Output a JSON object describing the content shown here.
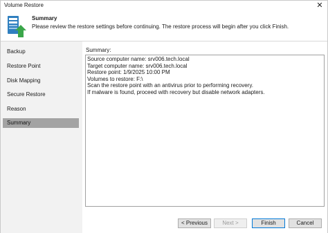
{
  "window": {
    "title": "Volume Restore",
    "close_glyph": "✕"
  },
  "header": {
    "icon": "server-restore-icon",
    "title": "Summary",
    "description": "Please review the restore settings before continuing. The restore process will begin after you click Finish."
  },
  "sidebar": {
    "items": [
      {
        "label": "Backup",
        "active": false
      },
      {
        "label": "Restore Point",
        "active": false
      },
      {
        "label": "Disk Mapping",
        "active": false
      },
      {
        "label": "Secure Restore",
        "active": false
      },
      {
        "label": "Reason",
        "active": false
      },
      {
        "label": "Summary",
        "active": true
      }
    ]
  },
  "summary": {
    "label": "Summary:",
    "lines": [
      "Source computer name: srv006.tech.local",
      "Target computer name: srv006.tech.local",
      "Restore point: 1/9/2025 10:00 PM",
      "Volumes to restore: F:\\",
      "Scan the restore point with an antivirus prior to performing recovery.",
      "If malware is found, proceed with recovery but disable network adapters."
    ]
  },
  "buttons": {
    "previous": "< Previous",
    "next": "Next >",
    "finish": "Finish",
    "cancel": "Cancel"
  },
  "colors": {
    "active_nav": "#a3a3a3",
    "sidebar_bg": "#f2f2f2",
    "focus_border": "#0078d7"
  }
}
